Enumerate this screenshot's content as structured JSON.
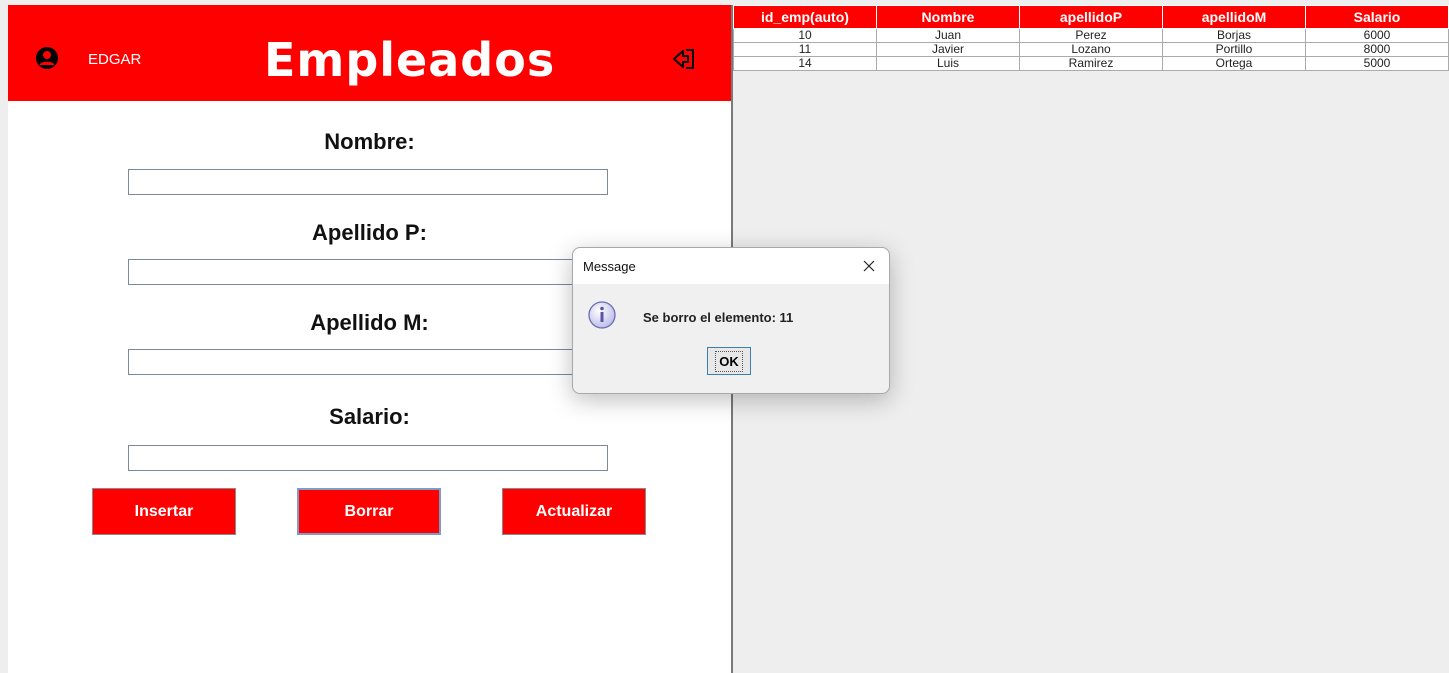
{
  "header": {
    "username": "EDGAR",
    "title": "Empleados"
  },
  "form": {
    "nombre_label": "Nombre:",
    "apellido_p_label": "Apellido P:",
    "apellido_m_label": "Apellido M:",
    "salario_label": "Salario:",
    "nombre_value": "",
    "apellido_p_value": "",
    "apellido_m_value": "",
    "salario_value": ""
  },
  "buttons": {
    "insertar": "Insertar",
    "borrar": "Borrar",
    "actualizar": "Actualizar"
  },
  "table": {
    "columns": [
      "id_emp(auto)",
      "Nombre",
      "apellidoP",
      "apellidoM",
      "Salario"
    ],
    "rows": [
      [
        "10",
        "Juan",
        "Perez",
        "Borjas",
        "6000"
      ],
      [
        "11",
        "Javier",
        "Lozano",
        "Portillo",
        "8000"
      ],
      [
        "14",
        "Luis",
        "Ramirez",
        "Ortega",
        "5000"
      ]
    ]
  },
  "dialog": {
    "title": "Message",
    "message": "Se borro el elemento: 11",
    "ok_label": "OK"
  },
  "colors": {
    "accent": "#ff0000",
    "background": "#eeeeee"
  },
  "icons": {
    "user": "user-circle-icon",
    "logout": "logout-icon",
    "info": "info-icon",
    "close": "close-icon"
  }
}
